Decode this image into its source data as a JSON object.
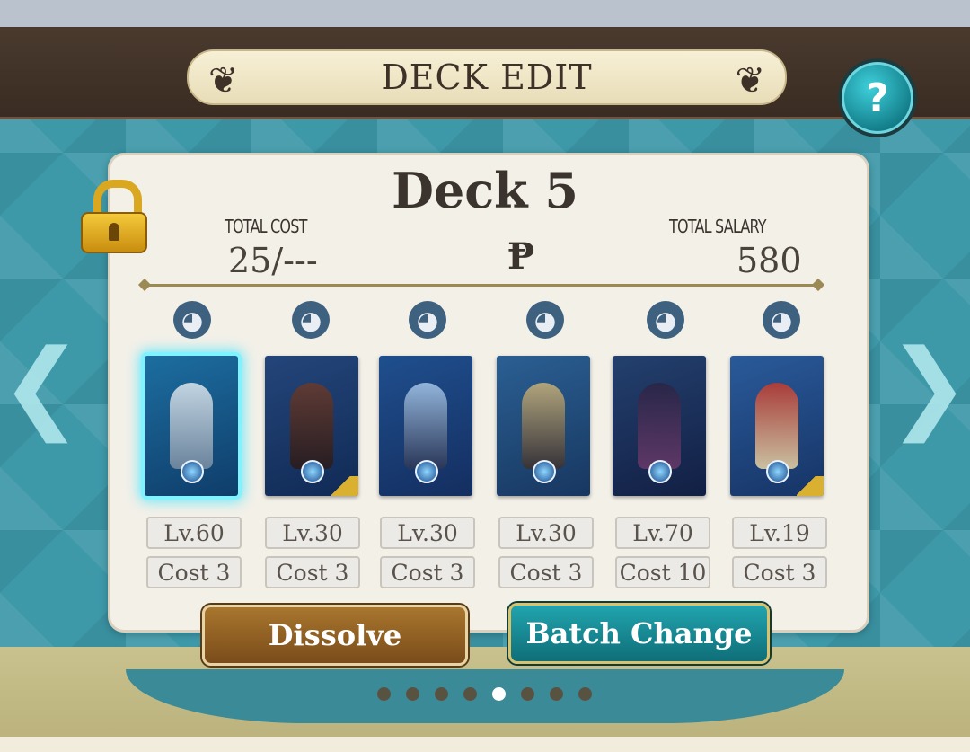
{
  "header": {
    "title": "DECK EDIT",
    "help_label": "?"
  },
  "deck": {
    "name": "Deck 5",
    "total_cost_label": "TOTAL COST",
    "total_cost_value": "25/---",
    "total_salary_label": "TOTAL SALARY",
    "total_salary_value": "580",
    "currency_symbol": "Ᵽ"
  },
  "cards": [
    {
      "level": "Lv.60",
      "cost": "Cost 3",
      "selected": true
    },
    {
      "level": "Lv.30",
      "cost": "Cost 3",
      "selected": false
    },
    {
      "level": "Lv.30",
      "cost": "Cost 3",
      "selected": false
    },
    {
      "level": "Lv.30",
      "cost": "Cost 3",
      "selected": false
    },
    {
      "level": "Lv.70",
      "cost": "Cost 10",
      "selected": false
    },
    {
      "level": "Lv.19",
      "cost": "Cost 3",
      "selected": false
    }
  ],
  "element_icon": "water-drop-icon",
  "buttons": {
    "dissolve": "Dissolve",
    "batch_change": "Batch Change"
  },
  "pagination": {
    "total": 8,
    "current": 5
  },
  "colors": {
    "accent_teal": "#1a8f9a",
    "panel_bg": "#f3f0e8",
    "header_brown": "#3a2c22"
  }
}
